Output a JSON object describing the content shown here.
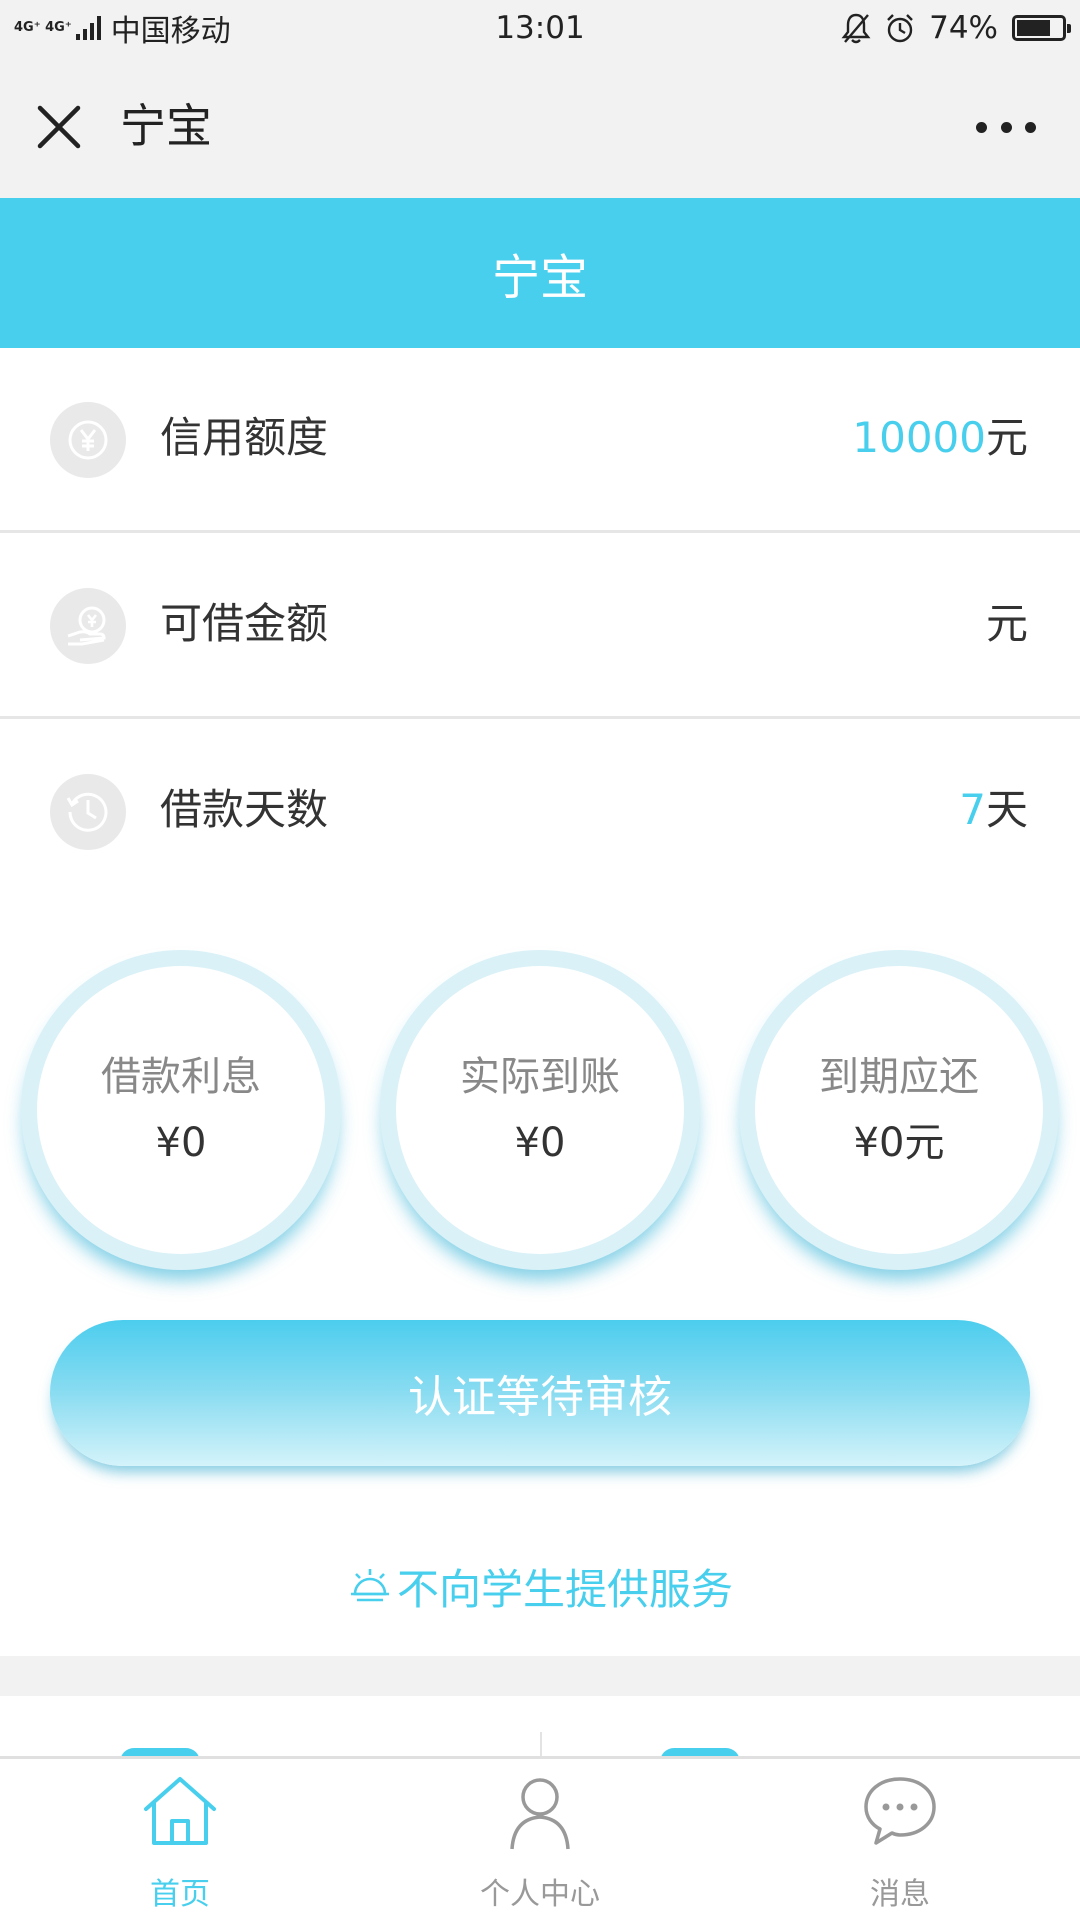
{
  "status_bar": {
    "network": "4G⁺ 4G⁺",
    "carrier": "中国移动",
    "time": "13:01",
    "battery_percent": "74%",
    "battery_level": 0.74
  },
  "nav": {
    "title": "宁宝",
    "icons": [
      "close-icon",
      "more-icon"
    ]
  },
  "header": {
    "title": "宁宝"
  },
  "rows": [
    {
      "label": "信用额度",
      "value_number": "10000",
      "value_unit": "元",
      "icon": "yen-coin-icon"
    },
    {
      "label": "可借金额",
      "value_number": "",
      "value_unit": "元",
      "icon": "hand-coin-icon"
    },
    {
      "label": "借款天数",
      "value_number": "7",
      "value_unit": "天",
      "icon": "clock-icon"
    }
  ],
  "circles": [
    {
      "label": "借款利息",
      "value": "¥0"
    },
    {
      "label": "实际到账",
      "value": "¥0"
    },
    {
      "label": "到期应还",
      "value": "¥0元"
    }
  ],
  "main_button": {
    "label": "认证等待审核"
  },
  "notice": {
    "text": "不向学生提供服务",
    "icon": "bell-icon"
  },
  "tabs": [
    {
      "label": "首页",
      "icon": "home-icon",
      "active": true
    },
    {
      "label": "个人中心",
      "icon": "person-icon",
      "active": false
    },
    {
      "label": "消息",
      "icon": "chat-icon",
      "active": false
    }
  ],
  "colors": {
    "accent": "#48cfed",
    "bar_background": "#f2f2f2",
    "inactive_tab": "#999999"
  }
}
